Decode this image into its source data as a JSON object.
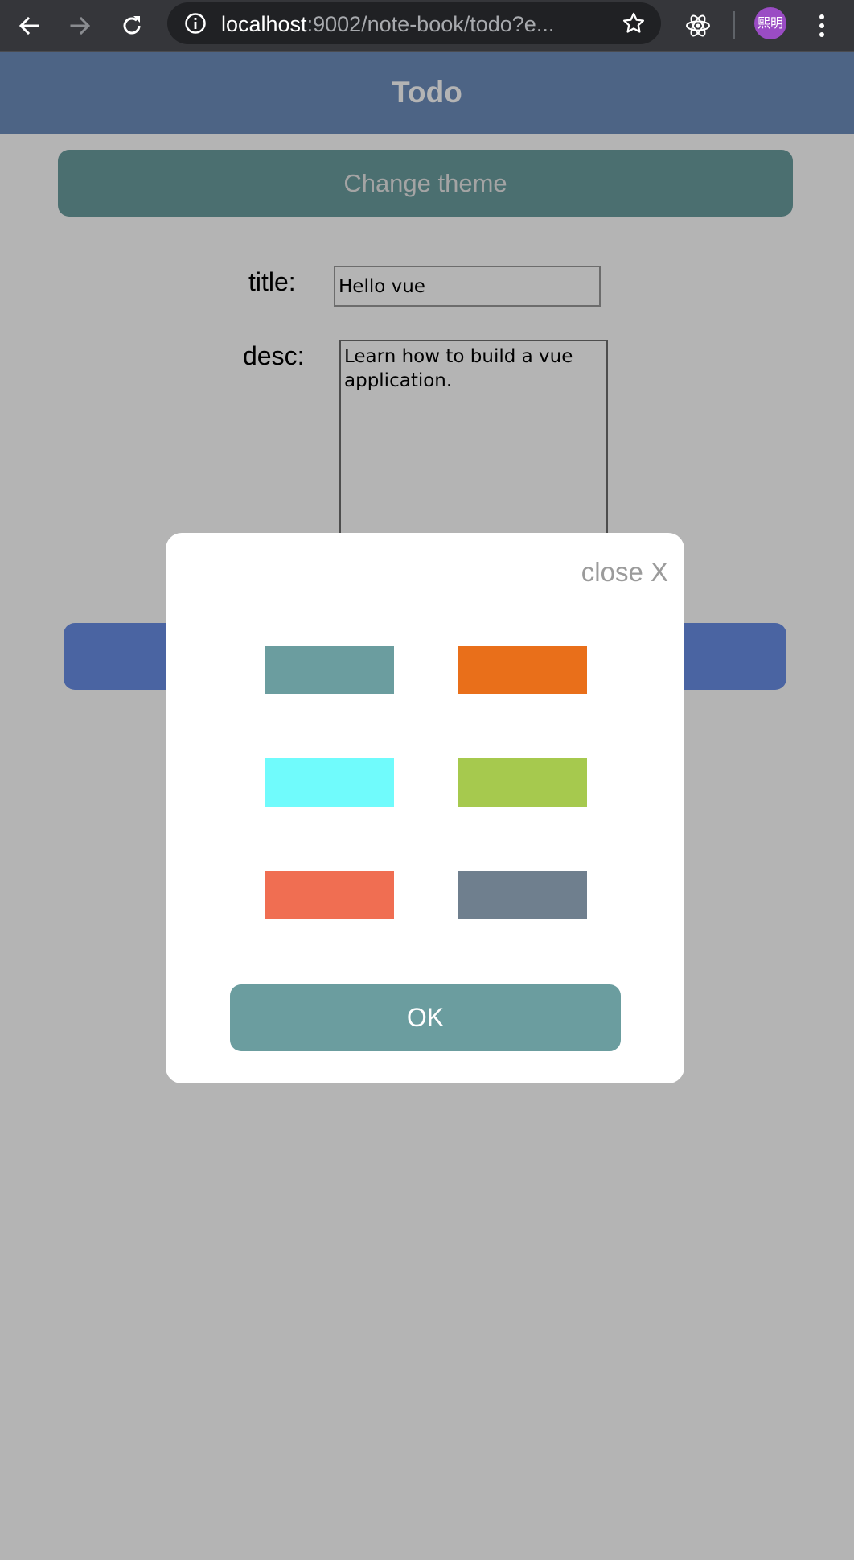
{
  "browser": {
    "back_icon": "arrow-left-icon",
    "forward_icon": "arrow-right-icon",
    "reload_icon": "reload-icon",
    "info_icon": "info-icon",
    "url_host": "localhost",
    "url_rest": ":9002/note-book/todo?e...",
    "bookmark_icon": "star-icon",
    "extension_icon": "react-atom-icon",
    "profile_text": "熙明",
    "profile_color": "#9a4cc4",
    "menu_icon": "kebab-menu-icon"
  },
  "header": {
    "title": "Todo",
    "color": "#6d8ebd"
  },
  "main": {
    "change_theme_label": "Change theme",
    "title_label": "title:",
    "title_value": "Hello vue",
    "desc_label": "desc:",
    "desc_value": "Learn how to build a vue application."
  },
  "modal": {
    "close_label": "close X",
    "ok_label": "OK",
    "swatches": [
      {
        "color": "#6b9d9f"
      },
      {
        "color": "#e96f1a"
      },
      {
        "color": "#70fbfc"
      },
      {
        "color": "#a6c94e"
      },
      {
        "color": "#f06e52"
      },
      {
        "color": "#6f7f8e"
      }
    ]
  },
  "colors": {
    "overlay": "rgba(0,0,0,0.294)",
    "accent_teal": "#6b9d9f",
    "submit_blue": "#6a8ee6"
  }
}
